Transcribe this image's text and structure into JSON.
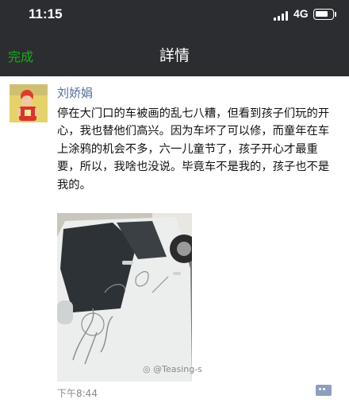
{
  "status_bar": {
    "time": "11:15",
    "network": "4G",
    "battery_level": 0.8
  },
  "nav": {
    "done_label": "完成",
    "title": "詳情"
  },
  "post": {
    "username": "刘娇娟",
    "text": "停在大门口的车被画的乱七八糟，但看到孩子们玩的开心，我也替他们高兴。因为车坏了可以修，而童年在车上涂鸦的机会不多，六一儿童节了，孩子开心才最重要，所以，我啥也没说。毕竟车不是我的，孩子也不是我的。",
    "photo_watermark": "@Teasing-s",
    "time": "下午8:44"
  },
  "colors": {
    "bar_bg": "#2b2d30",
    "accent_green": "#1aad19",
    "name_blue": "#576b95"
  },
  "icons": [
    "signal-icon",
    "battery-icon",
    "comment-icon",
    "weibo-icon"
  ]
}
